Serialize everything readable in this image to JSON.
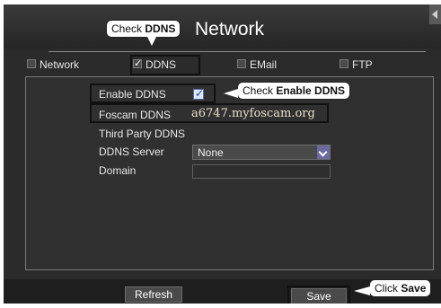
{
  "window": {
    "title": "Network"
  },
  "tabs": [
    {
      "label": "Network",
      "checked": false
    },
    {
      "label": "DDNS",
      "checked": true
    },
    {
      "label": "EMail",
      "checked": false
    },
    {
      "label": "FTP",
      "checked": false
    }
  ],
  "form": {
    "enable_ddns_label": "Enable DDNS",
    "enable_ddns_checked": true,
    "foscam_ddns_label": "Foscam DDNS",
    "foscam_ddns_value": "a6747.myfoscam.org",
    "third_party_label": "Third Party DDNS",
    "ddns_server_label": "DDNS Server",
    "ddns_server_value": "None",
    "domain_label": "Domain",
    "domain_value": ""
  },
  "footer": {
    "refresh_label": "Refresh",
    "save_label": "Save"
  },
  "callouts": {
    "ddns": {
      "prefix": "Check ",
      "bold": "DDNS"
    },
    "enable": {
      "prefix": "Check ",
      "bold": "Enable DDNS"
    },
    "save": {
      "prefix": "Click ",
      "bold": "Save"
    }
  },
  "icons": {
    "check": "✓",
    "corner": "back-arrow-icon"
  },
  "colors": {
    "background": "#2b2b2b",
    "panel": "#303030",
    "highlight_border": "#111111",
    "checkbox_checked": "#1a3fb0"
  }
}
